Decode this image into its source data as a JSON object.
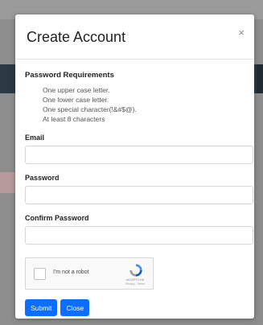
{
  "modal": {
    "title": "Create Account",
    "close_symbol": "×"
  },
  "requirements": {
    "title": "Password Requirements",
    "items": [
      "One upper case letter.",
      "One lower case letter.",
      "One special character(!&#$@).",
      "At least 8 characters"
    ]
  },
  "form": {
    "email_label": "Email",
    "email_value": "",
    "password_label": "Password",
    "password_value": "",
    "confirm_password_label": "Confirm Password",
    "confirm_password_value": ""
  },
  "recaptcha": {
    "label": "I'm not a robot",
    "brand": "reCAPTCHA",
    "links": "Privacy - Terms",
    "icon": "recaptcha-logo-icon"
  },
  "actions": {
    "submit_label": "Submit",
    "close_label": "Close"
  },
  "colors": {
    "primary": "#0d6efd",
    "backdrop": "#8d8d8d",
    "header_bar": "#2b3945"
  }
}
